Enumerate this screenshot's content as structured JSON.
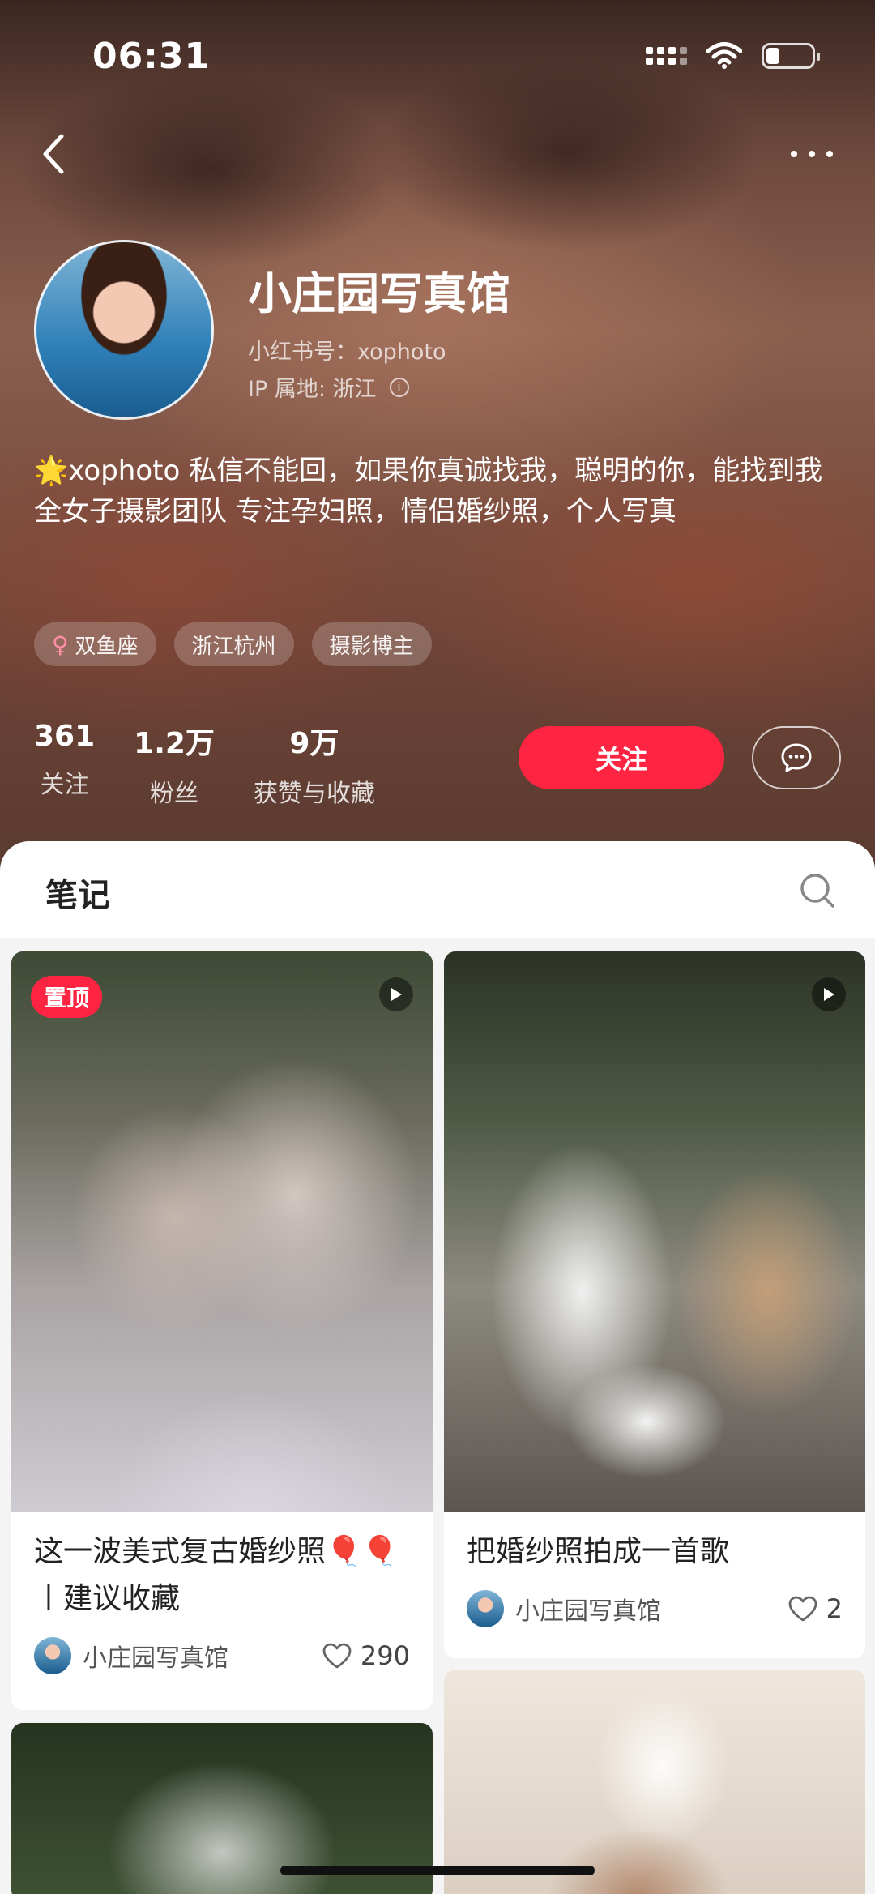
{
  "status_bar": {
    "time": "06:31"
  },
  "profile": {
    "name": "小庄园写真馆",
    "account_id": "小红书号：xophoto",
    "ip_location": "IP 属地: 浙江",
    "bio_line1": "xophoto 私信不能回，如果你真诚找我，聪明的你，能找到我",
    "bio_line2": "全女子摄影团队 专注孕妇照，情侣婚纱照，个人写真",
    "bio_emoji": "🌟",
    "tags": [
      "双鱼座",
      "浙江杭州",
      "摄影博主"
    ],
    "female_symbol": "♀",
    "stats": [
      {
        "value": "361",
        "label": "关注"
      },
      {
        "value": "1.2万",
        "label": "粉丝"
      },
      {
        "value": "9万",
        "label": "获赞与收藏"
      }
    ],
    "follow_label": "关注"
  },
  "tabs": {
    "notes_label": "笔记"
  },
  "posts": [
    {
      "pinned_label": "置顶",
      "title": "这一波美式复古婚纱照🎈🎈 丨建议收藏",
      "author": "小庄园写真馆",
      "likes": "290"
    },
    {
      "title": "把婚纱照拍成一首歌",
      "author": "小庄园写真馆",
      "likes": "2"
    }
  ],
  "colors": {
    "accent": "#ff2442"
  },
  "icons": [
    "back-arrow-icon",
    "more-icon",
    "info-icon",
    "chat-bubble-icon",
    "search-icon",
    "play-icon",
    "heart-icon"
  ]
}
